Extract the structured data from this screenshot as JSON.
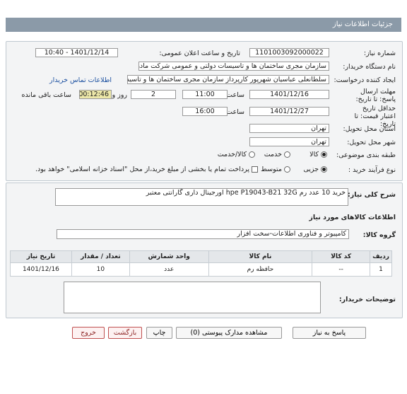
{
  "page_title": "جزئیات اطلاعات نیاز",
  "form": {
    "need_number_label": "شماره نیاز:",
    "need_number": "1101003092000022",
    "announce_label": "تاریخ و ساعت اعلان عمومی:",
    "announce_value": "1401/12/14 - 10:40",
    "buyer_org_label": "نام دستگاه خریدار:",
    "buyer_org": "سازمان مجری ساختمان ها و تاسیسات دولتی و عمومی  شرکت مادر تخصصی",
    "requester_label": "ایجاد کننده درخواست:",
    "requester": "سلطانعلی عباسیان شهرپور کارپرداز سازمان مجری ساختمان ها و تاسیسات د",
    "contact_link": "اطلاعات تماس خریدار",
    "deadline_label": "مهلت ارسال پاسخ: تا تاریخ:",
    "deadline_date": "1401/12/16",
    "time_word": "ساعت",
    "deadline_time": "11:00",
    "days_value": "2",
    "days_word": "روز و",
    "remaining_time": "00:12:46",
    "remaining_label": "ساعت باقی مانده",
    "min_validity_label": "حداقل تاریخ اعتبار قیمت: تا تاریخ:",
    "validity_date": "1401/12/27",
    "validity_time": "16:00",
    "province_label": "استان محل تحویل:",
    "province": "تهران",
    "city_label": "شهر محل تحویل:",
    "city": "تهران",
    "category_label": "طبقه بندی موضوعی:",
    "cat_goods": "کالا",
    "cat_service": "خدمت",
    "cat_goods_service": "کالا/خدمت",
    "purchase_type_label": "نوع فرآیند خرید :",
    "type_partial": "جزیی",
    "type_medium": "متوسط",
    "payment_note": "پرداخت تمام یا بخشی از مبلغ خرید،از محل \"اسناد خزانه اسلامی\" خواهد بود."
  },
  "description": {
    "label": "شرح کلی نیاز:",
    "text": "خرید 10 عدد رم  hpe  P19043-B21 32G اورجینال داری گارانتی معتبر"
  },
  "goods_info": {
    "title": "اطلاعات کالاهای مورد نیاز",
    "group_label": "گروه کالا:",
    "group_value": "کامپیوتر و فناوری اطلاعات-سخت افزار"
  },
  "table": {
    "headers": {
      "row": "ردیف",
      "code": "کد کالا",
      "name": "نام کالا",
      "unit": "واحد شمارش",
      "qty": "تعداد / مقدار",
      "date": "تاریخ نیاز"
    },
    "rows": [
      {
        "row": "1",
        "code": "--",
        "name": "حافظه رم",
        "unit": "عدد",
        "qty": "10",
        "date": "1401/12/16"
      }
    ]
  },
  "buyer_notes": {
    "label": "توضیحات خریدار:",
    "text": ""
  },
  "buttons": {
    "reply": "پاسخ به نیاز",
    "view_docs": "مشاهده مدارک پیوستی (0)",
    "print": "چاپ",
    "back": "بازگشت",
    "exit": "خروج"
  }
}
